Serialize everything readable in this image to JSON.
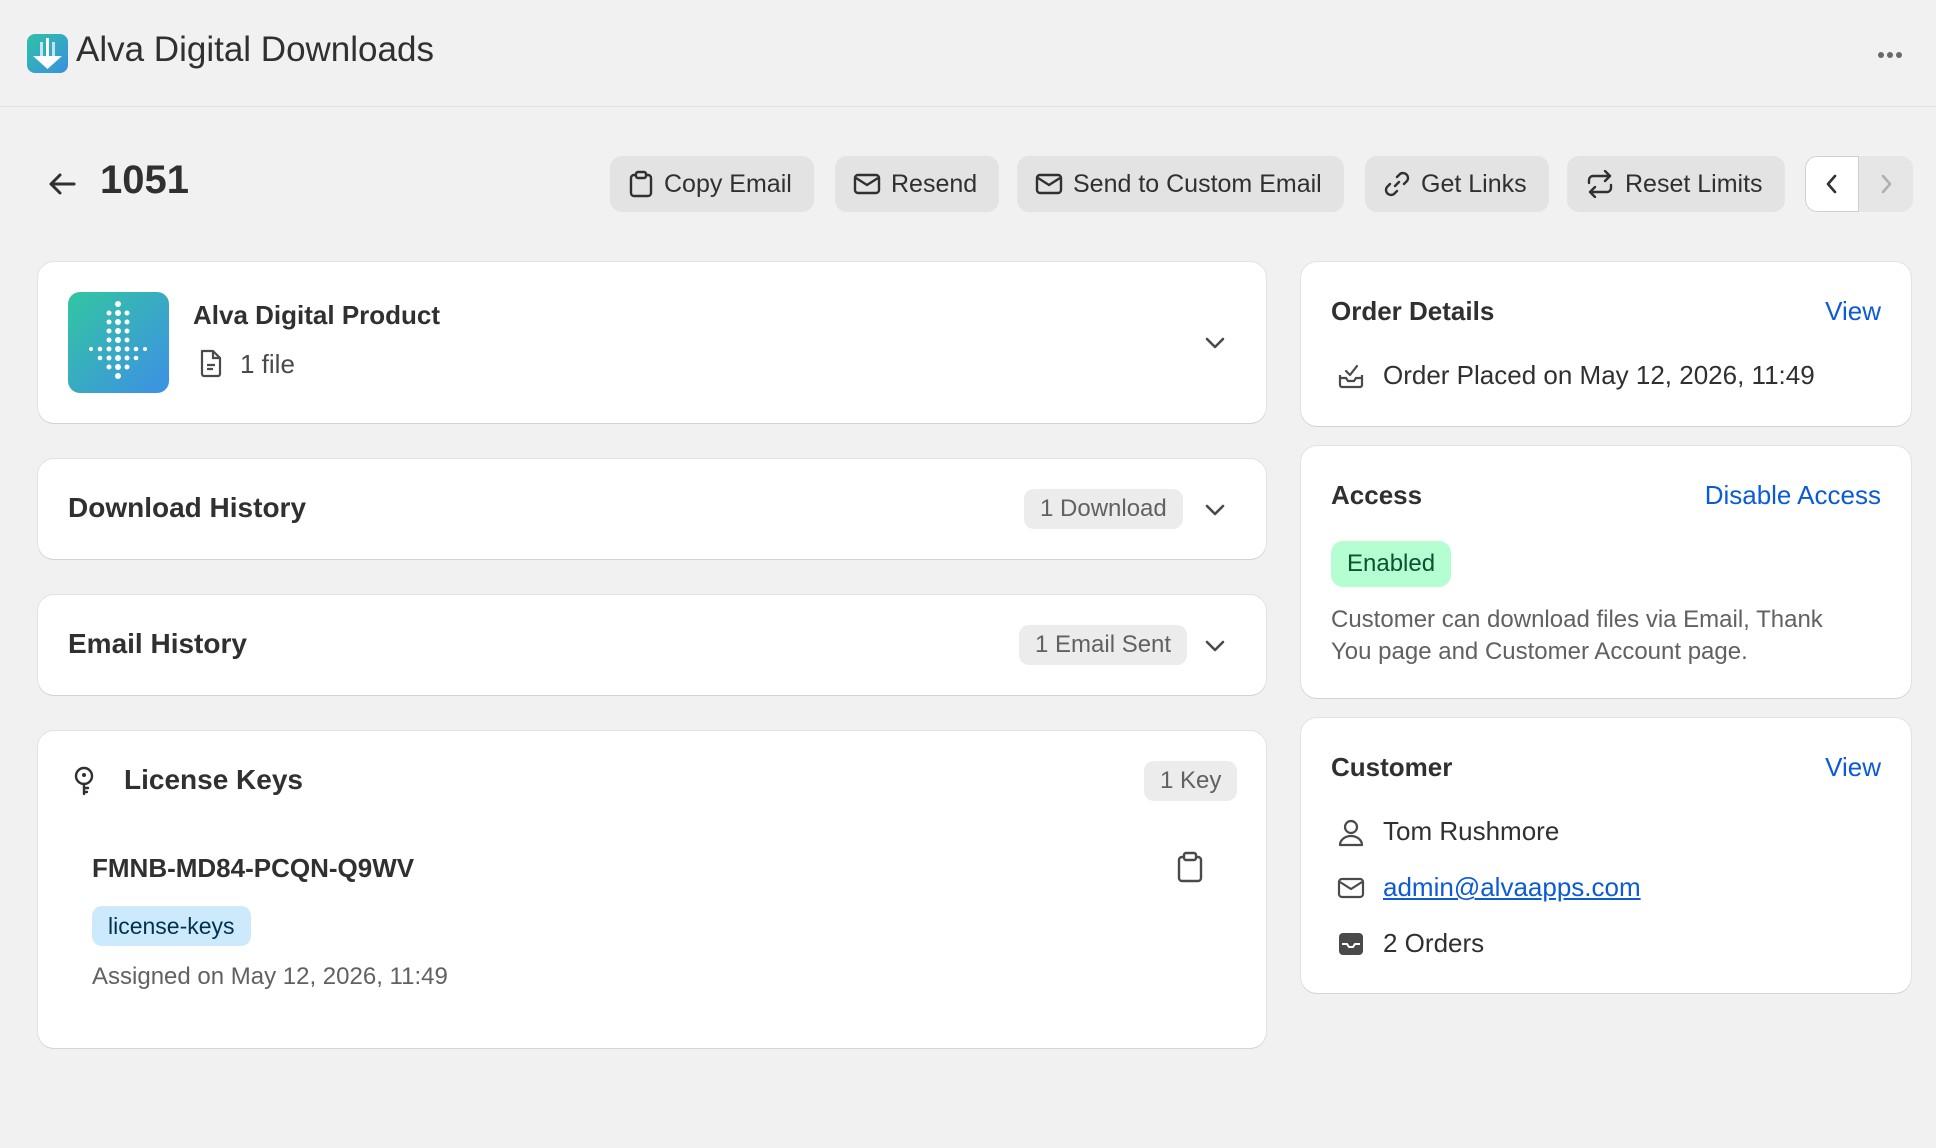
{
  "app": {
    "title": "Alva Digital Downloads",
    "more_icon": "horizontal-dots-icon"
  },
  "page": {
    "title": "1051"
  },
  "actions": [
    {
      "label": "Copy Email",
      "icon": "clipboard-icon"
    },
    {
      "label": "Resend",
      "icon": "mail-icon"
    },
    {
      "label": "Send to Custom Email",
      "icon": "mail-icon"
    },
    {
      "label": "Get Links",
      "icon": "link-icon"
    },
    {
      "label": "Reset Limits",
      "icon": "refresh-icon"
    }
  ],
  "product": {
    "name": "Alva Digital Product",
    "files": "1 file"
  },
  "download_history": {
    "title": "Download History",
    "badge": "1 Download"
  },
  "email_history": {
    "title": "Email History",
    "badge": "1 Email Sent"
  },
  "license_keys": {
    "title": "License Keys",
    "badge": "1 Key",
    "key": "FMNB-MD84-PCQN-Q9WV",
    "tag": "license-keys",
    "assigned": "Assigned on May 12, 2026, 11:49"
  },
  "order_details": {
    "title": "Order Details",
    "link": "View",
    "placed": "Order Placed on May 12, 2026, 11:49"
  },
  "access": {
    "title": "Access",
    "link": "Disable Access",
    "status": "Enabled",
    "status_color": "#b4fed2",
    "description_line1": "Customer can download files via Email, Thank",
    "description_line2": "You page and Customer Account page."
  },
  "customer": {
    "title": "Customer",
    "link": "View",
    "name": "Tom Rushmore",
    "email": "admin@alvaapps.com",
    "orders": "2 Orders"
  },
  "colors": {
    "link": "#0c5bd6",
    "background": "#f1f1f1",
    "badge_tag": "#cdeafd"
  }
}
